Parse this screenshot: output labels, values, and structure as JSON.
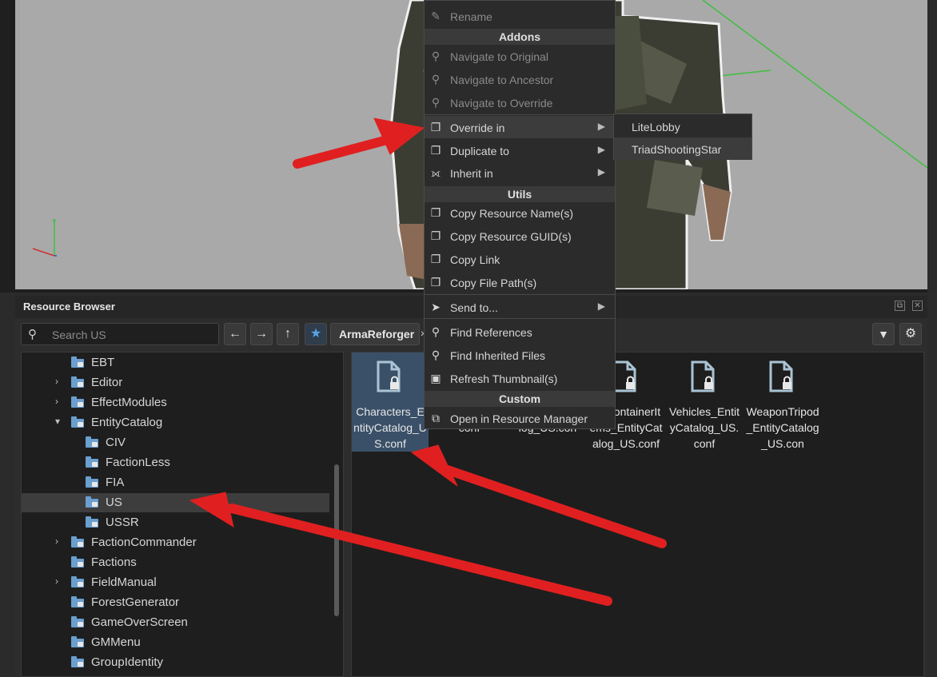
{
  "panel": {
    "title": "Resource Browser"
  },
  "search": {
    "placeholder": "Search US"
  },
  "breadcrumb": {
    "label": "ArmaReforger",
    "separator": "›"
  },
  "tree": {
    "items": [
      {
        "label": "EBT",
        "expandable": false
      },
      {
        "label": "Editor",
        "expandable": true
      },
      {
        "label": "EffectModules",
        "expandable": true
      },
      {
        "label": "EntityCatalog",
        "expandable": true,
        "expanded": true
      },
      {
        "label": "CIV",
        "expandable": false
      },
      {
        "label": "FactionLess",
        "expandable": false
      },
      {
        "label": "FIA",
        "expandable": false
      },
      {
        "label": "US",
        "expandable": false,
        "selected": true
      },
      {
        "label": "USSR",
        "expandable": false
      },
      {
        "label": "FactionCommander",
        "expandable": true
      },
      {
        "label": "Factions",
        "expandable": false
      },
      {
        "label": "FieldManual",
        "expandable": true
      },
      {
        "label": "ForestGenerator",
        "expandable": false
      },
      {
        "label": "GameOverScreen",
        "expandable": false
      },
      {
        "label": "GMMenu",
        "expandable": false
      },
      {
        "label": "GroupIdentity",
        "expandable": false
      }
    ]
  },
  "files": [
    {
      "name": "Characters_EntityCatalog_US.conf",
      "selected": true
    },
    {
      "name": "yCatalog_US.conf"
    },
    {
      "name": "ms_EntityCatalog_US.con"
    },
    {
      "name": "plyContainerItems_EntityCatalog_US.conf"
    },
    {
      "name": "Vehicles_EntityCatalog_US.conf"
    },
    {
      "name": "WeaponTripod_EntityCatalog_US.con"
    }
  ],
  "context_menu": {
    "rename": "Rename",
    "sections": {
      "addons": "Addons",
      "utils": "Utils",
      "custom": "Custom"
    },
    "items": {
      "navigate_original": "Navigate to Original",
      "navigate_ancestor": "Navigate to Ancestor",
      "navigate_override": "Navigate to Override",
      "override_in": "Override in",
      "duplicate_to": "Duplicate to",
      "inherit_in": "Inherit in",
      "copy_name": "Copy Resource Name(s)",
      "copy_guid": "Copy Resource GUID(s)",
      "copy_link": "Copy Link",
      "copy_path": "Copy File Path(s)",
      "send_to": "Send to...",
      "find_refs": "Find References",
      "find_inherited": "Find Inherited Files",
      "refresh_thumb": "Refresh Thumbnail(s)",
      "open_manager": "Open in Resource Manager"
    }
  },
  "submenu": {
    "items": [
      "LiteLobby",
      "TriadShootingStar"
    ]
  },
  "colors": {
    "accent": "#5aa2e6",
    "folder": "#6a9fd0",
    "selection": "#3a5068",
    "annotation_arrow": "#e02020"
  }
}
